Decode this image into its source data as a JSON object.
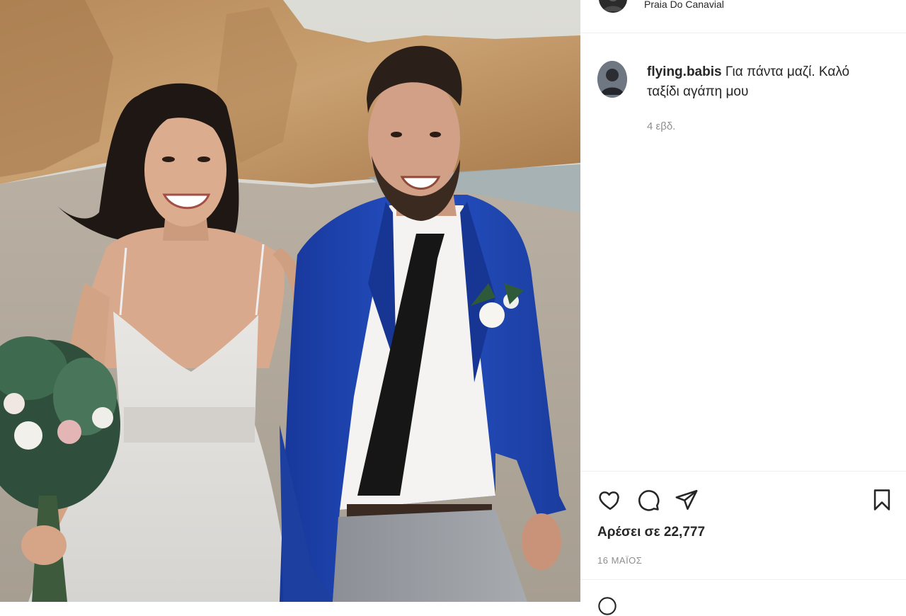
{
  "post": {
    "location": "Praia Do Canavial",
    "caption": {
      "username": "flying.babis",
      "text": "Για πάντα μαζί. Καλό ταξίδι αγάπη μου"
    },
    "age": "4 εβδ.",
    "likes_text": "Αρέσει σε 22,777",
    "date": "16 ΜΑΪΟΣ"
  },
  "icons": {
    "like": "heart-icon",
    "comment": "comment-icon",
    "share": "paper-plane-icon",
    "save": "bookmark-icon",
    "emoji": "smiley-icon"
  },
  "colors": {
    "text": "#262626",
    "muted": "#8e8e8e",
    "border": "#efefef",
    "suit": "#1f46a8"
  }
}
